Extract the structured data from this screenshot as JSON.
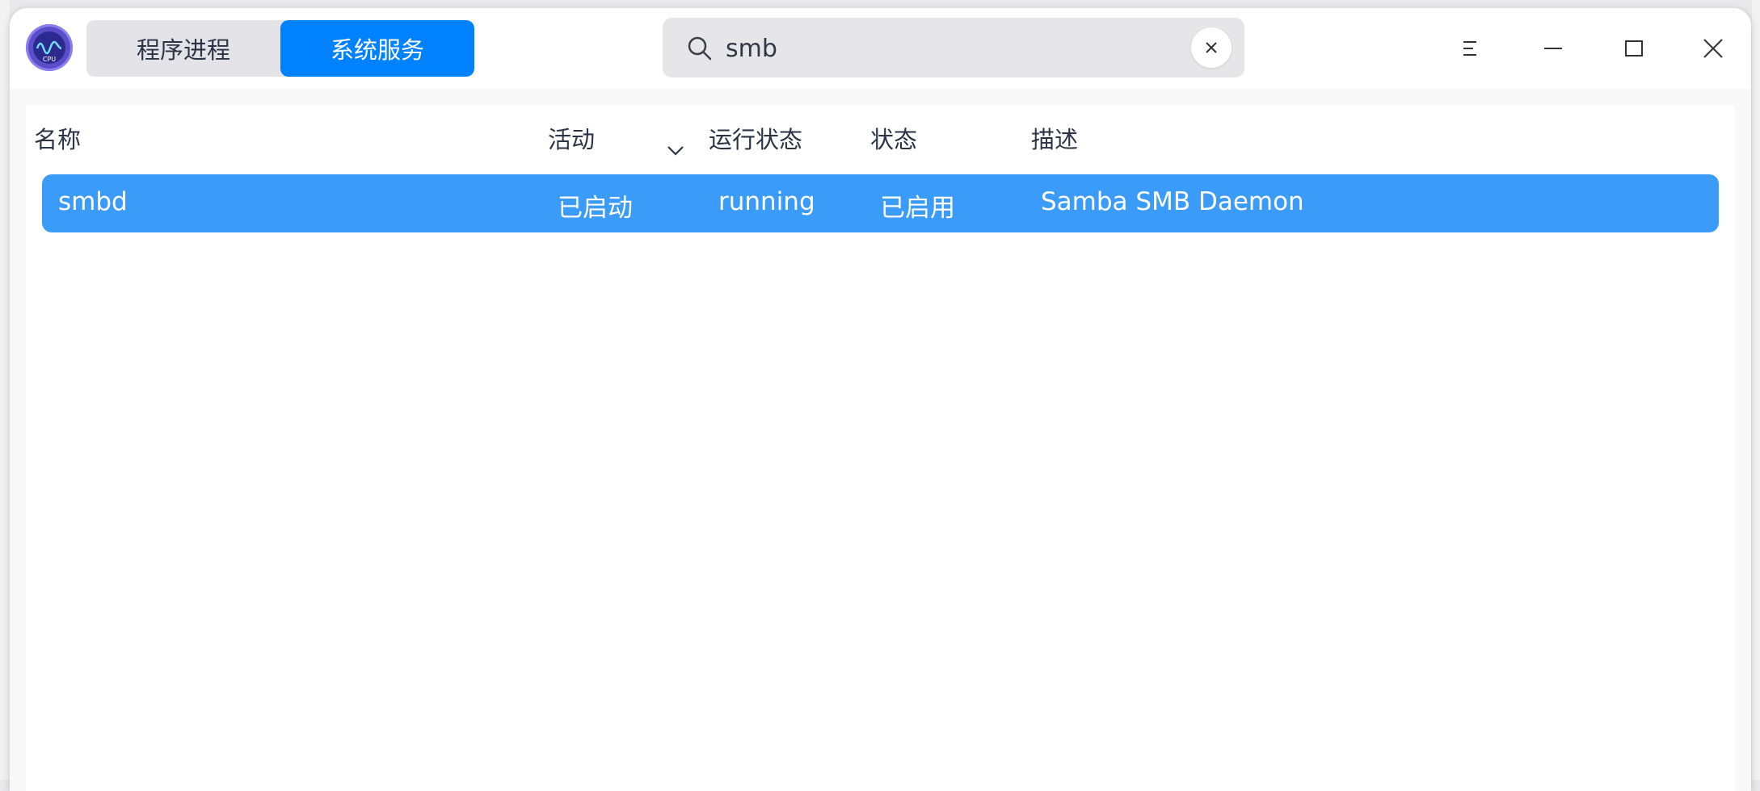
{
  "tabs": [
    {
      "label": "程序进程",
      "active": false
    },
    {
      "label": "系统服务",
      "active": true
    }
  ],
  "search": {
    "value": "smb",
    "placeholder": ""
  },
  "columns": {
    "name": "名称",
    "active": "活动",
    "run_state": "运行状态",
    "state": "状态",
    "description": "描述"
  },
  "rows": [
    {
      "name": "smbd",
      "active": "已启动",
      "run_state": "running",
      "state": "已启用",
      "description": "Samba SMB Daemon",
      "selected": true
    }
  ],
  "logo": {
    "badge_text": "CPU"
  },
  "colors": {
    "accent": "#0081ff",
    "selected_row": "#3a9bf8",
    "logo": "#5b4fc9"
  },
  "icons": [
    "app-logo-icon",
    "search-icon",
    "clear-icon",
    "menu-icon",
    "minimize-icon",
    "maximize-icon",
    "close-icon",
    "chevron-down-icon"
  ]
}
